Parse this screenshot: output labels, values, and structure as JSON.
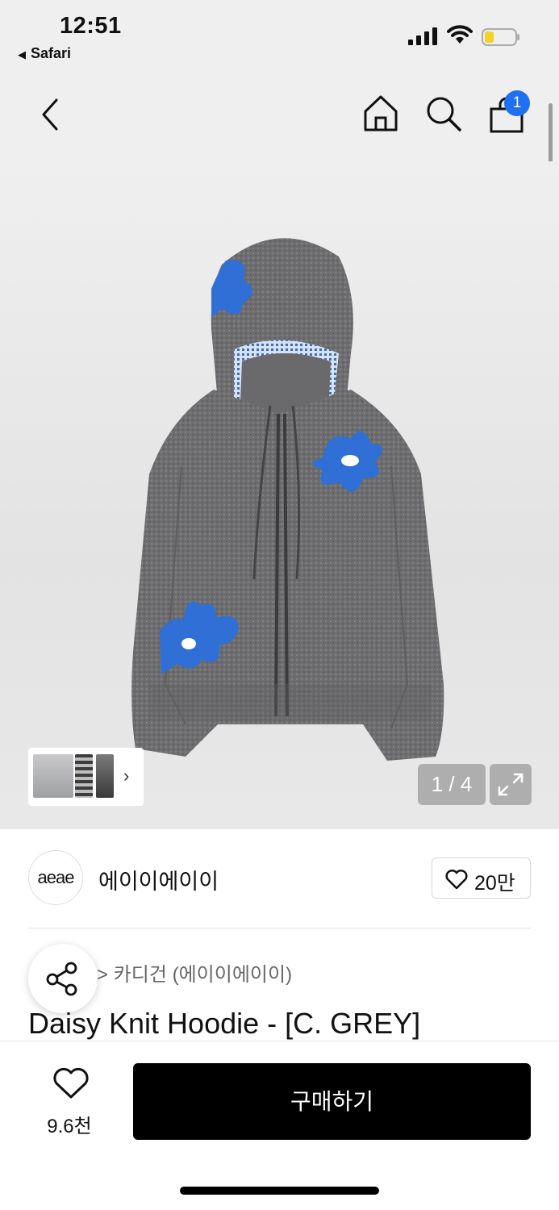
{
  "status_bar": {
    "time": "12:51",
    "back_app": "Safari",
    "back_arrow": "◀"
  },
  "nav": {
    "cart_badge": "1",
    "icons": [
      "back-chevron-icon",
      "home-icon",
      "search-icon",
      "shopping-bag-icon"
    ]
  },
  "gallery": {
    "counter": "1 / 4",
    "thumbs_more": "›"
  },
  "brand": {
    "logo_text": "aeae",
    "name": "에이이에이이",
    "favorite_count": "20만"
  },
  "product": {
    "category": "> 카디건 (에이이에이이)",
    "title": "Daisy Knit Hoodie - [C. GREY]"
  },
  "bottom_bar": {
    "like_count": "9.6천",
    "buy_label": "구매하기"
  },
  "colors": {
    "accent_badge": "#1f6ff2",
    "buy_button": "#000000",
    "hoodie_grey": "#6f6f71",
    "flower_blue": "#2f6fd6"
  }
}
